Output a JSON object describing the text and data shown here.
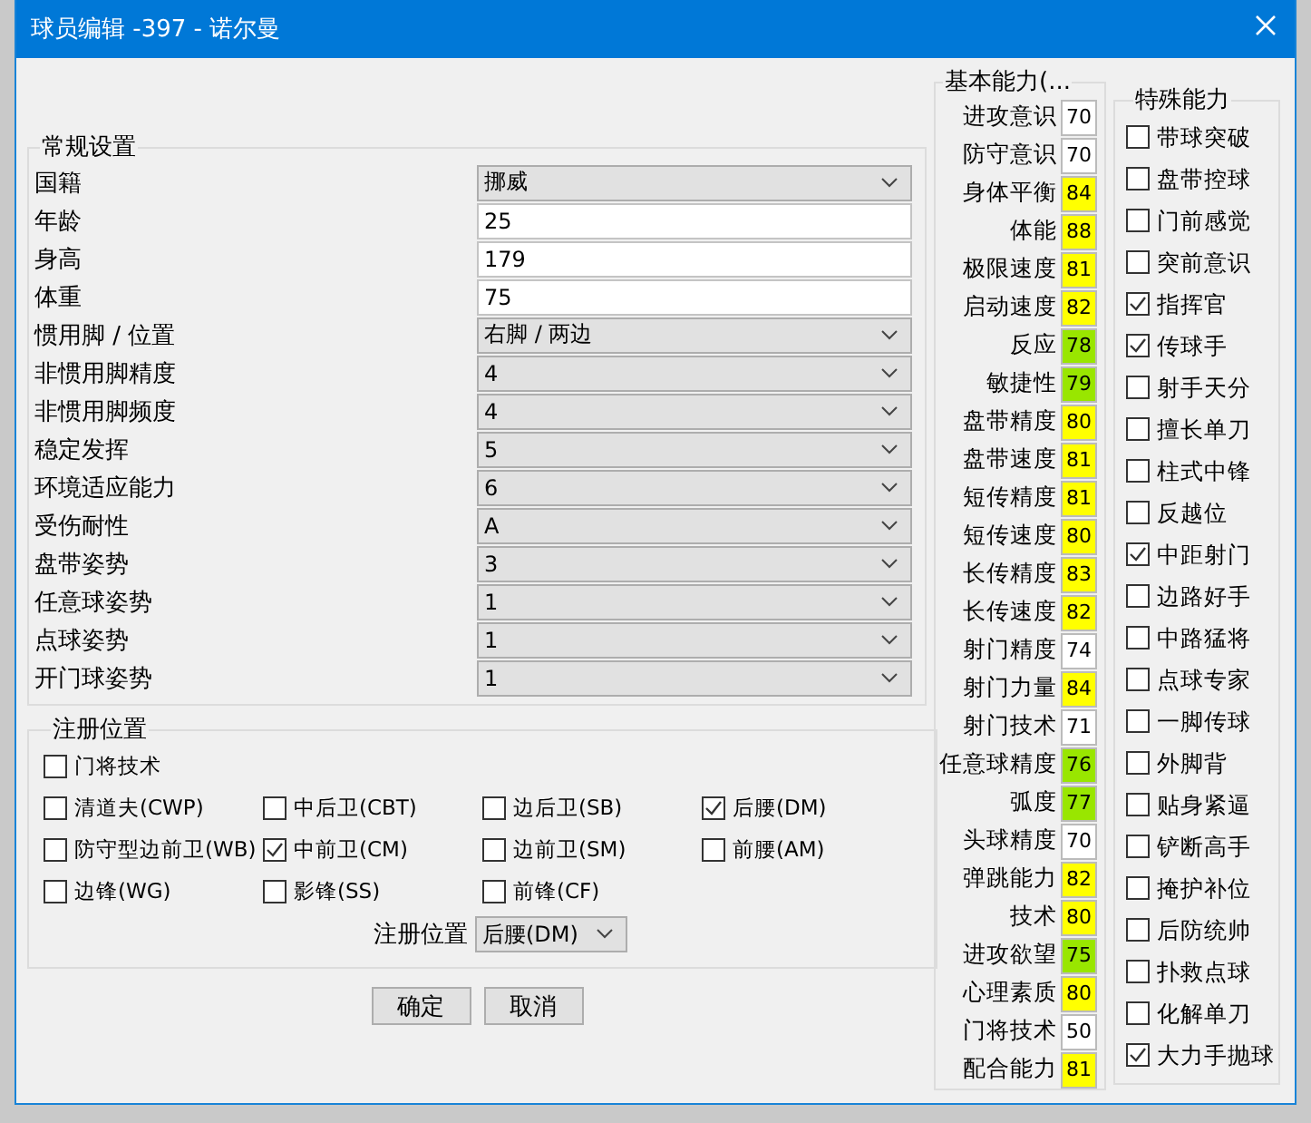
{
  "window": {
    "title": "球员编辑 -397 - 诺尔曼"
  },
  "general_settings": {
    "title": "常规设置",
    "rows": [
      {
        "label": "国籍",
        "kind": "select",
        "value": "挪威"
      },
      {
        "label": "年龄",
        "kind": "input",
        "value": "25"
      },
      {
        "label": "身高",
        "kind": "input",
        "value": "179"
      },
      {
        "label": "体重",
        "kind": "input",
        "value": "75"
      },
      {
        "label": "惯用脚 / 位置",
        "kind": "select",
        "value": "右脚 / 两边"
      },
      {
        "label": "非惯用脚精度",
        "kind": "select",
        "value": "4"
      },
      {
        "label": "非惯用脚频度",
        "kind": "select",
        "value": "4"
      },
      {
        "label": "稳定发挥",
        "kind": "select",
        "value": "5"
      },
      {
        "label": "环境适应能力",
        "kind": "select",
        "value": "6"
      },
      {
        "label": "受伤耐性",
        "kind": "select",
        "value": "A"
      },
      {
        "label": "盘带姿势",
        "kind": "select",
        "value": "3"
      },
      {
        "label": "任意球姿势",
        "kind": "select",
        "value": "1"
      },
      {
        "label": "点球姿势",
        "kind": "select",
        "value": "1"
      },
      {
        "label": "开门球姿势",
        "kind": "select",
        "value": "1"
      }
    ]
  },
  "registered_positions": {
    "title": "注册位置",
    "rows": [
      [
        {
          "label": "门将技术",
          "checked": false
        }
      ],
      [
        {
          "label": "清道夫(CWP)",
          "checked": false
        },
        {
          "label": "中后卫(CBT)",
          "checked": false
        },
        {
          "label": "边后卫(SB)",
          "checked": false
        },
        {
          "label": "后腰(DM)",
          "checked": true
        }
      ],
      [
        {
          "label": "防守型边前卫(WB)",
          "checked": false
        },
        {
          "label": "中前卫(CM)",
          "checked": true
        },
        {
          "label": "边前卫(SM)",
          "checked": false
        },
        {
          "label": "前腰(AM)",
          "checked": false
        }
      ],
      [
        {
          "label": "边锋(WG)",
          "checked": false
        },
        {
          "label": "影锋(SS)",
          "checked": false
        },
        {
          "label": "前锋(CF)",
          "checked": false
        }
      ]
    ],
    "register_select": {
      "label": "注册位置",
      "value": "后腰(DM)"
    }
  },
  "buttons": [
    "确定",
    "取消"
  ],
  "basic_abilities": {
    "title": "基本能力(...",
    "items": [
      {
        "label": "进攻意识",
        "value": "70",
        "color": "#ffffff"
      },
      {
        "label": "防守意识",
        "value": "70",
        "color": "#ffffff"
      },
      {
        "label": "身体平衡",
        "value": "84",
        "color": "#ffff00"
      },
      {
        "label": "体能",
        "value": "88",
        "color": "#ffff00"
      },
      {
        "label": "极限速度",
        "value": "81",
        "color": "#ffff00"
      },
      {
        "label": "启动速度",
        "value": "82",
        "color": "#ffff00"
      },
      {
        "label": "反应",
        "value": "78",
        "color": "#99e600"
      },
      {
        "label": "敏捷性",
        "value": "79",
        "color": "#99e600"
      },
      {
        "label": "盘带精度",
        "value": "80",
        "color": "#ffff00"
      },
      {
        "label": "盘带速度",
        "value": "81",
        "color": "#ffff00"
      },
      {
        "label": "短传精度",
        "value": "81",
        "color": "#ffff00"
      },
      {
        "label": "短传速度",
        "value": "80",
        "color": "#ffff00"
      },
      {
        "label": "长传精度",
        "value": "83",
        "color": "#ffff00"
      },
      {
        "label": "长传速度",
        "value": "82",
        "color": "#ffff00"
      },
      {
        "label": "射门精度",
        "value": "74",
        "color": "#ffffff"
      },
      {
        "label": "射门力量",
        "value": "84",
        "color": "#ffff00"
      },
      {
        "label": "射门技术",
        "value": "71",
        "color": "#ffffff"
      },
      {
        "label": "任意球精度",
        "value": "76",
        "color": "#99e600"
      },
      {
        "label": "弧度",
        "value": "77",
        "color": "#99e600"
      },
      {
        "label": "头球精度",
        "value": "70",
        "color": "#ffffff"
      },
      {
        "label": "弹跳能力",
        "value": "82",
        "color": "#ffff00"
      },
      {
        "label": "技术",
        "value": "80",
        "color": "#ffff00"
      },
      {
        "label": "进攻欲望",
        "value": "75",
        "color": "#99e600"
      },
      {
        "label": "心理素质",
        "value": "80",
        "color": "#ffff00"
      },
      {
        "label": "门将技术",
        "value": "50",
        "color": "#ffffff"
      },
      {
        "label": "配合能力",
        "value": "81",
        "color": "#ffff00"
      }
    ]
  },
  "special_abilities": {
    "title": "特殊能力",
    "items": [
      {
        "label": "带球突破",
        "checked": false
      },
      {
        "label": "盘带控球",
        "checked": false
      },
      {
        "label": "门前感觉",
        "checked": false
      },
      {
        "label": "突前意识",
        "checked": false
      },
      {
        "label": "指挥官",
        "checked": true
      },
      {
        "label": "传球手",
        "checked": true
      },
      {
        "label": "射手天分",
        "checked": false
      },
      {
        "label": "擅长单刀",
        "checked": false
      },
      {
        "label": "柱式中锋",
        "checked": false
      },
      {
        "label": "反越位",
        "checked": false
      },
      {
        "label": "中距射门",
        "checked": true
      },
      {
        "label": "边路好手",
        "checked": false
      },
      {
        "label": "中路猛将",
        "checked": false
      },
      {
        "label": "点球专家",
        "checked": false
      },
      {
        "label": "一脚传球",
        "checked": false
      },
      {
        "label": "外脚背",
        "checked": false
      },
      {
        "label": "贴身紧逼",
        "checked": false
      },
      {
        "label": "铲断高手",
        "checked": false
      },
      {
        "label": "掩护补位",
        "checked": false
      },
      {
        "label": "后防统帅",
        "checked": false
      },
      {
        "label": "扑救点球",
        "checked": false
      },
      {
        "label": "化解单刀",
        "checked": false
      },
      {
        "label": "大力手抛球",
        "checked": true
      }
    ]
  }
}
